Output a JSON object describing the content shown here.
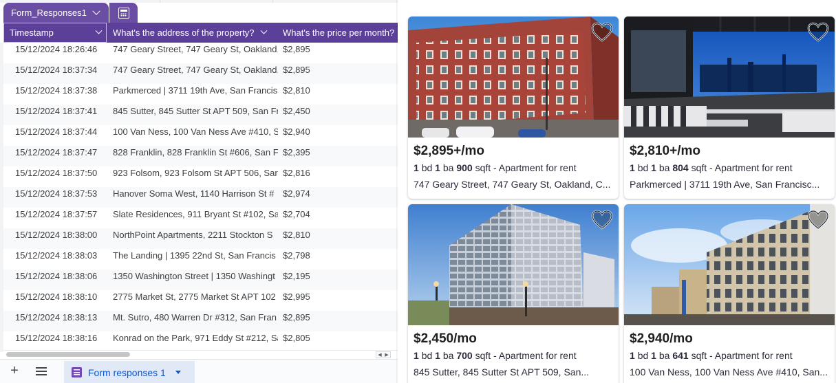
{
  "sheet": {
    "table_name": "Form_Responses1",
    "columns": [
      "Timestamp",
      "What's the address of the property?",
      "What's the price per month?"
    ],
    "rows": [
      {
        "timestamp": "15/12/2024 18:26:46",
        "address": "747 Geary Street, 747 Geary St, Oakland,",
        "price": "$2,895"
      },
      {
        "timestamp": "15/12/2024 18:37:34",
        "address": "747 Geary Street, 747 Geary St, Oakland,",
        "price": "$2,895"
      },
      {
        "timestamp": "15/12/2024 18:37:38",
        "address": "Parkmerced | 3711 19th Ave, San Francis",
        "price": "$2,810"
      },
      {
        "timestamp": "15/12/2024 18:37:41",
        "address": "845 Sutter, 845 Sutter St APT 509, San Fr",
        "price": "$2,450"
      },
      {
        "timestamp": "15/12/2024 18:37:44",
        "address": "100 Van Ness, 100 Van Ness Ave #410, S",
        "price": "$2,940"
      },
      {
        "timestamp": "15/12/2024 18:37:47",
        "address": "828 Franklin, 828 Franklin St #606, San F",
        "price": "$2,395"
      },
      {
        "timestamp": "15/12/2024 18:37:50",
        "address": "923 Folsom, 923 Folsom St APT 506, Sar",
        "price": "$2,816"
      },
      {
        "timestamp": "15/12/2024 18:37:53",
        "address": "Hanover Soma West, 1140 Harrison St #",
        "price": "$2,974"
      },
      {
        "timestamp": "15/12/2024 18:37:57",
        "address": "Slate Residences, 911 Bryant St #102, Sa",
        "price": "$2,704"
      },
      {
        "timestamp": "15/12/2024 18:38:00",
        "address": "NorthPoint Apartments, 2211 Stockton S",
        "price": "$2,810"
      },
      {
        "timestamp": "15/12/2024 18:38:03",
        "address": "The Landing | 1395 22nd St, San Francis",
        "price": "$2,798"
      },
      {
        "timestamp": "15/12/2024 18:38:06",
        "address": "1350 Washington Street | 1350 Washingt",
        "price": "$2,195"
      },
      {
        "timestamp": "15/12/2024 18:38:10",
        "address": "2775 Market St, 2775 Market St APT 102",
        "price": "$2,995"
      },
      {
        "timestamp": "15/12/2024 18:38:13",
        "address": "Mt. Sutro, 480 Warren Dr #312, San Fran",
        "price": "$2,895"
      },
      {
        "timestamp": "15/12/2024 18:38:16",
        "address": "Konrad on the Park, 971 Eddy St #212, Sa",
        "price": "$2,805"
      }
    ],
    "add_sheet": "+",
    "sheet_tab": "Form responses 1"
  },
  "listings": [
    {
      "price": "$2,895+/mo",
      "bd": "1",
      "ba": "1",
      "sqft": "900",
      "bd_label": "bd",
      "ba_label": "ba",
      "sqft_label": "sqft",
      "type": "- Apartment for rent",
      "address": "747 Geary Street, 747 Geary St, Oakland, C...",
      "image": "red-brick-building-photo"
    },
    {
      "price": "$2,810+/mo",
      "bd": "1",
      "ba": "1",
      "sqft": "804",
      "bd_label": "bd",
      "ba_label": "ba",
      "sqft_label": "sqft",
      "type": "- Apartment for rent",
      "address": "Parkmerced | 3711 19th Ave, San Francisc...",
      "image": "rooftop-terrace-photo"
    },
    {
      "price": "$2,450/mo",
      "bd": "1",
      "ba": "1",
      "sqft": "700",
      "bd_label": "bd",
      "ba_label": "ba",
      "sqft_label": "sqft",
      "type": "- Apartment for rent",
      "address": "845 Sutter, 845 Sutter St APT 509, San...",
      "image": "modern-tower-dusk-photo"
    },
    {
      "price": "$2,940/mo",
      "bd": "1",
      "ba": "1",
      "sqft": "641",
      "bd_label": "bd",
      "ba_label": "ba",
      "sqft_label": "sqft",
      "type": "- Apartment for rent",
      "address": "100 Van Ness, 100 Van Ness Ave #410, San...",
      "image": "street-buildings-photo"
    }
  ],
  "colors": {
    "table_header": "#5b3f99",
    "table_tab": "#6a4ea3",
    "sheet_tab_bg": "#e1e9f7",
    "sheet_tab_text": "#0b57d0"
  }
}
